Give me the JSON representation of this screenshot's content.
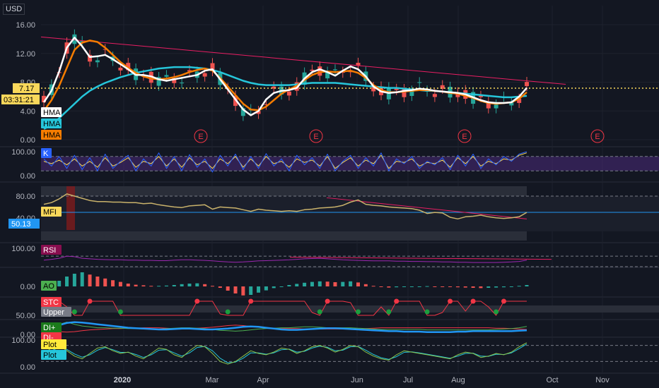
{
  "currency": "USD",
  "chart_data": {
    "type": "line",
    "price_pane": {
      "ylim": [
        0,
        17.5
      ],
      "yticks": [
        "16.00",
        "12.00",
        "8.00",
        "4.00",
        "0.00"
      ],
      "last_price_label": "7.17",
      "last_price": 7.17,
      "countdown": "03:31:21",
      "legend": [
        {
          "label": "HMA",
          "color": "#ffffff",
          "text_color": "#000000"
        },
        {
          "label": "HMA",
          "color": "#26c6da",
          "text_color": "#000000"
        },
        {
          "label": "HMA",
          "color": "#f57c00",
          "text_color": "#000000"
        }
      ],
      "series": [
        {
          "name": "HMA",
          "color": "#ffffff",
          "values": [
            5.2,
            6.8,
            9.5,
            12.8,
            14.2,
            13.0,
            11.5,
            11.6,
            11.8,
            11.2,
            10.5,
            9.8,
            9.0,
            9.0,
            8.8,
            8.4,
            8.2,
            8.4,
            8.6,
            8.8,
            9.0,
            9.6,
            9.8,
            8.4,
            7.0,
            5.6,
            4.2,
            3.4,
            4.0,
            5.6,
            6.5,
            6.8,
            6.9,
            7.2,
            8.5,
            9.4,
            9.8,
            9.4,
            8.9,
            9.6,
            10.2,
            9.8,
            8.8,
            7.4,
            6.7,
            6.5,
            6.6,
            6.8,
            6.9,
            7.1,
            7.0,
            6.8,
            6.7,
            6.6,
            6.5,
            6.3,
            5.9,
            5.5,
            5.2,
            5.1,
            5.1,
            5.2,
            6.0,
            7.2
          ]
        },
        {
          "name": "HMA",
          "color": "#26c6da",
          "values": [
            1.5,
            2.0,
            3.0,
            4.0,
            5.0,
            6.0,
            6.8,
            7.4,
            7.9,
            8.3,
            8.7,
            9.0,
            9.3,
            9.5,
            9.7,
            9.9,
            10.0,
            10.1,
            10.1,
            10.1,
            10.0,
            9.9,
            9.7,
            9.4,
            9.0,
            8.6,
            8.2,
            7.9,
            7.7,
            7.6,
            7.6,
            7.6,
            7.6,
            7.7,
            7.8,
            7.9,
            7.9,
            7.9,
            7.9,
            7.8,
            7.7,
            7.6,
            7.5,
            7.4,
            7.3,
            7.2,
            7.2,
            7.1,
            7.0,
            6.9,
            6.8,
            6.8,
            6.7,
            6.6,
            6.5,
            6.4,
            6.3,
            6.2,
            6.1,
            6.0,
            5.9,
            5.9,
            6.0,
            6.1
          ]
        },
        {
          "name": "HMA",
          "color": "#f57c00",
          "values": [
            4.0,
            5.5,
            7.5,
            10.0,
            12.5,
            13.5,
            13.8,
            13.6,
            12.8,
            11.8,
            10.8,
            10.0,
            9.3,
            8.8,
            8.5,
            8.4,
            8.5,
            8.7,
            9.0,
            9.4,
            9.7,
            9.9,
            9.6,
            8.6,
            7.4,
            6.2,
            5.0,
            4.2,
            4.1,
            4.6,
            5.5,
            6.4,
            7.0,
            7.5,
            8.3,
            9.0,
            9.4,
            9.5,
            9.4,
            9.5,
            9.6,
            9.3,
            8.6,
            7.6,
            6.9,
            6.6,
            6.6,
            6.7,
            6.8,
            6.9,
            6.9,
            6.8,
            6.7,
            6.5,
            6.4,
            6.1,
            5.8,
            5.4,
            5.1,
            5.0,
            5.1,
            5.2,
            5.7,
            6.6
          ]
        }
      ],
      "earnings_markers": [
        "E",
        "E",
        "E",
        "E"
      ]
    },
    "stoch_pane": {
      "yticks": [
        "100.00",
        "0.00"
      ],
      "legend": [
        {
          "label": "K",
          "color": "#2962ff",
          "text_color": "#ffffff"
        }
      ],
      "series": [
        {
          "name": "K",
          "color": "#2962ff",
          "values": [
            70,
            40,
            80,
            30,
            85,
            25,
            75,
            20,
            90,
            30,
            60,
            85,
            20,
            70,
            40,
            95,
            30,
            80,
            20,
            88,
            35,
            70,
            15,
            85,
            40,
            90,
            25,
            80,
            30,
            92,
            40,
            70,
            20,
            85,
            45,
            75,
            30,
            90,
            20,
            60,
            85,
            30,
            75,
            40,
            95,
            20,
            70,
            50,
            80,
            30,
            60,
            45,
            75,
            25,
            85,
            40,
            90,
            30,
            70,
            45,
            80,
            60,
            90,
            100
          ]
        },
        {
          "name": "D",
          "color": "#f9d85b",
          "values": [
            60,
            50,
            65,
            45,
            70,
            40,
            60,
            35,
            75,
            40,
            55,
            75,
            35,
            60,
            50,
            80,
            40,
            70,
            35,
            75,
            45,
            60,
            30,
            70,
            50,
            80,
            35,
            70,
            40,
            80,
            50,
            60,
            35,
            70,
            55,
            65,
            40,
            80,
            30,
            55,
            75,
            40,
            65,
            50,
            85,
            30,
            60,
            55,
            70,
            40,
            55,
            50,
            65,
            35,
            75,
            50,
            80,
            40,
            60,
            50,
            70,
            65,
            85,
            95
          ]
        }
      ]
    },
    "mfi_pane": {
      "yticks": [
        "80.00",
        "40.00"
      ],
      "legend": [
        {
          "label": "MFI",
          "color": "#f9d85b",
          "text_color": "#000000"
        }
      ],
      "last_value_label": "50.13",
      "last_value": 50.13,
      "series": [
        {
          "name": "MFI",
          "color": "#c9b26b",
          "values": [
            65,
            68,
            75,
            84,
            80,
            76,
            72,
            70,
            70,
            69,
            69,
            68,
            68,
            66,
            67,
            64,
            62,
            60,
            59,
            62,
            63,
            64,
            56,
            60,
            59,
            58,
            55,
            52,
            56,
            54,
            53,
            52,
            53,
            52,
            55,
            56,
            58,
            59,
            60,
            63,
            69,
            73,
            65,
            63,
            62,
            60,
            59,
            58,
            57,
            54,
            48,
            50,
            49,
            41,
            38,
            42,
            43,
            45,
            42,
            40,
            39,
            40,
            42,
            50
          ]
        }
      ]
    },
    "rsi_pane": {
      "yticks": [
        "100.00"
      ],
      "legend": [
        {
          "label": "RSI",
          "color": "#880e4f",
          "text_color": "#ffffff"
        }
      ],
      "series": [
        {
          "name": "RSI",
          "color": "#9c27b0",
          "values": [
            55,
            58,
            62,
            70,
            68,
            62,
            60,
            58,
            57,
            56,
            56,
            55,
            55,
            54,
            54,
            53,
            53,
            55,
            56,
            56,
            55,
            54,
            52,
            50,
            48,
            47,
            48,
            50,
            52,
            53,
            54,
            55,
            56,
            58,
            60,
            61,
            62,
            60,
            58,
            56,
            55,
            54,
            53,
            52,
            52,
            52,
            51,
            51,
            50,
            50,
            49,
            49,
            48,
            48,
            47,
            47,
            46,
            46,
            46,
            46,
            47,
            48,
            50,
            55
          ]
        }
      ]
    },
    "ao_pane": {
      "yticks": [
        "0.00"
      ],
      "legend": [
        {
          "label": "AO",
          "color": "#4caf50",
          "text_color": "#000000"
        }
      ],
      "values": [
        0.5,
        1.0,
        2.0,
        3.5,
        4.5,
        5.0,
        4.2,
        3.5,
        2.8,
        2.2,
        1.6,
        1.0,
        0.6,
        0.4,
        0.2,
        0.2,
        0.3,
        0.5,
        0.8,
        1.0,
        1.1,
        0.8,
        0.2,
        -0.5,
        -1.5,
        -2.5,
        -3.2,
        -3.0,
        -2.2,
        -1.4,
        -0.6,
        0.0,
        0.5,
        0.9,
        1.3,
        1.6,
        1.8,
        1.7,
        1.5,
        1.6,
        1.8,
        1.4,
        0.8,
        0.2,
        -0.2,
        -0.4,
        -0.3,
        -0.2,
        -0.1,
        0.0,
        0.1,
        0.0,
        -0.1,
        -0.2,
        -0.3,
        -0.4,
        -0.5,
        -0.6,
        -0.5,
        -0.4,
        -0.3,
        -0.1,
        0.2,
        0.5
      ]
    },
    "stc_pane": {
      "yticks": [
        "50.00"
      ],
      "legend": [
        {
          "label": "STC",
          "color": "#f23645",
          "text_color": "#ffffff"
        },
        {
          "label": "Upper",
          "color": "#787b86",
          "text_color": "#ffffff"
        }
      ],
      "series": [
        {
          "name": "STC",
          "color": "#f23645",
          "values": [
            90,
            100,
            100,
            60,
            0,
            0,
            100,
            100,
            100,
            100,
            0,
            0,
            0,
            0,
            0,
            0,
            0,
            0,
            0,
            0,
            100,
            100,
            100,
            10,
            0,
            0,
            0,
            100,
            100,
            100,
            100,
            100,
            100,
            100,
            100,
            20,
            0,
            100,
            100,
            100,
            90,
            0,
            0,
            0,
            60,
            0,
            100,
            100,
            100,
            100,
            0,
            0,
            20,
            100,
            100,
            30,
            100,
            100,
            60,
            0,
            100,
            100,
            100,
            100
          ]
        }
      ]
    },
    "dmi_pane": {
      "yticks": [
        "0.00"
      ],
      "legend": [
        {
          "label": "DI+",
          "color": "#1b7a1b",
          "text_color": "#ffffff"
        },
        {
          "label": "DI-",
          "color": "#f23645",
          "text_color": "#ffffff"
        }
      ],
      "series": [
        {
          "name": "ADX",
          "color": "#2196f3",
          "values": [
            18,
            22,
            28,
            33,
            35,
            34,
            32,
            30,
            28,
            26,
            24,
            22,
            21,
            20,
            19,
            18,
            18,
            19,
            20,
            20,
            19,
            18,
            18,
            19,
            20,
            22,
            24,
            25,
            24,
            22,
            20,
            18,
            17,
            17,
            18,
            19,
            20,
            21,
            21,
            20,
            19,
            18,
            17,
            16,
            15,
            14,
            14,
            13,
            13,
            13,
            12,
            12,
            12,
            12,
            13,
            13,
            14,
            14,
            14,
            14,
            14,
            14,
            15,
            16
          ]
        },
        {
          "name": "DI+",
          "color": "#4caf50",
          "values": [
            20,
            25,
            30,
            35,
            30,
            26,
            24,
            22,
            22,
            21,
            21,
            20,
            20,
            19,
            19,
            19,
            20,
            21,
            22,
            22,
            21,
            20,
            18,
            16,
            15,
            14,
            15,
            17,
            19,
            20,
            21,
            22,
            22,
            23,
            24,
            24,
            23,
            22,
            22,
            22,
            22,
            21,
            20,
            19,
            18,
            18,
            18,
            18,
            18,
            18,
            17,
            17,
            17,
            17,
            17,
            17,
            17,
            17,
            17,
            18,
            19,
            20,
            22,
            25
          ]
        },
        {
          "name": "DI-",
          "color": "#f23645",
          "values": [
            15,
            14,
            13,
            12,
            13,
            15,
            17,
            18,
            19,
            20,
            20,
            21,
            21,
            22,
            22,
            22,
            21,
            20,
            20,
            20,
            21,
            22,
            23,
            25,
            27,
            28,
            27,
            25,
            23,
            22,
            21,
            20,
            20,
            20,
            19,
            19,
            19,
            19,
            19,
            19,
            19,
            19,
            20,
            21,
            22,
            22,
            22,
            22,
            22,
            22,
            22,
            22,
            22,
            22,
            22,
            22,
            22,
            22,
            22,
            21,
            21,
            20,
            19,
            18
          ]
        }
      ]
    },
    "osc_pane": {
      "yticks": [
        "100.00",
        "0.00"
      ],
      "legend": [
        {
          "label": "Plot",
          "color": "#ffeb3b",
          "text_color": "#000000"
        },
        {
          "label": "Plot",
          "color": "#26c6da",
          "text_color": "#000000"
        }
      ],
      "series": [
        {
          "name": "Plot",
          "color": "#ffeb3b",
          "values": [
            50,
            70,
            80,
            60,
            40,
            30,
            50,
            70,
            75,
            60,
            50,
            55,
            40,
            30,
            50,
            70,
            65,
            45,
            35,
            60,
            80,
            75,
            50,
            20,
            10,
            20,
            40,
            60,
            50,
            45,
            55,
            70,
            65,
            50,
            60,
            75,
            80,
            70,
            55,
            65,
            80,
            75,
            55,
            40,
            30,
            25,
            45,
            60,
            55,
            50,
            45,
            40,
            35,
            30,
            45,
            55,
            50,
            35,
            40,
            50,
            45,
            55,
            75,
            90
          ]
        },
        {
          "name": "Plot",
          "color": "#26c6da",
          "values": [
            45,
            60,
            72,
            65,
            48,
            36,
            45,
            62,
            72,
            64,
            54,
            54,
            46,
            35,
            45,
            62,
            64,
            52,
            40,
            52,
            72,
            76,
            60,
            32,
            15,
            18,
            32,
            52,
            52,
            47,
            52,
            64,
            66,
            55,
            58,
            70,
            77,
            73,
            60,
            62,
            75,
            76,
            62,
            46,
            34,
            28,
            38,
            54,
            56,
            52,
            47,
            42,
            37,
            32,
            40,
            50,
            51,
            40,
            39,
            47,
            46,
            52,
            68,
            85
          ]
        }
      ]
    },
    "x_ticks": [
      "2020",
      "Mar",
      "Apr",
      "Jun",
      "Jul",
      "Aug",
      "Oct",
      "Nov"
    ]
  }
}
